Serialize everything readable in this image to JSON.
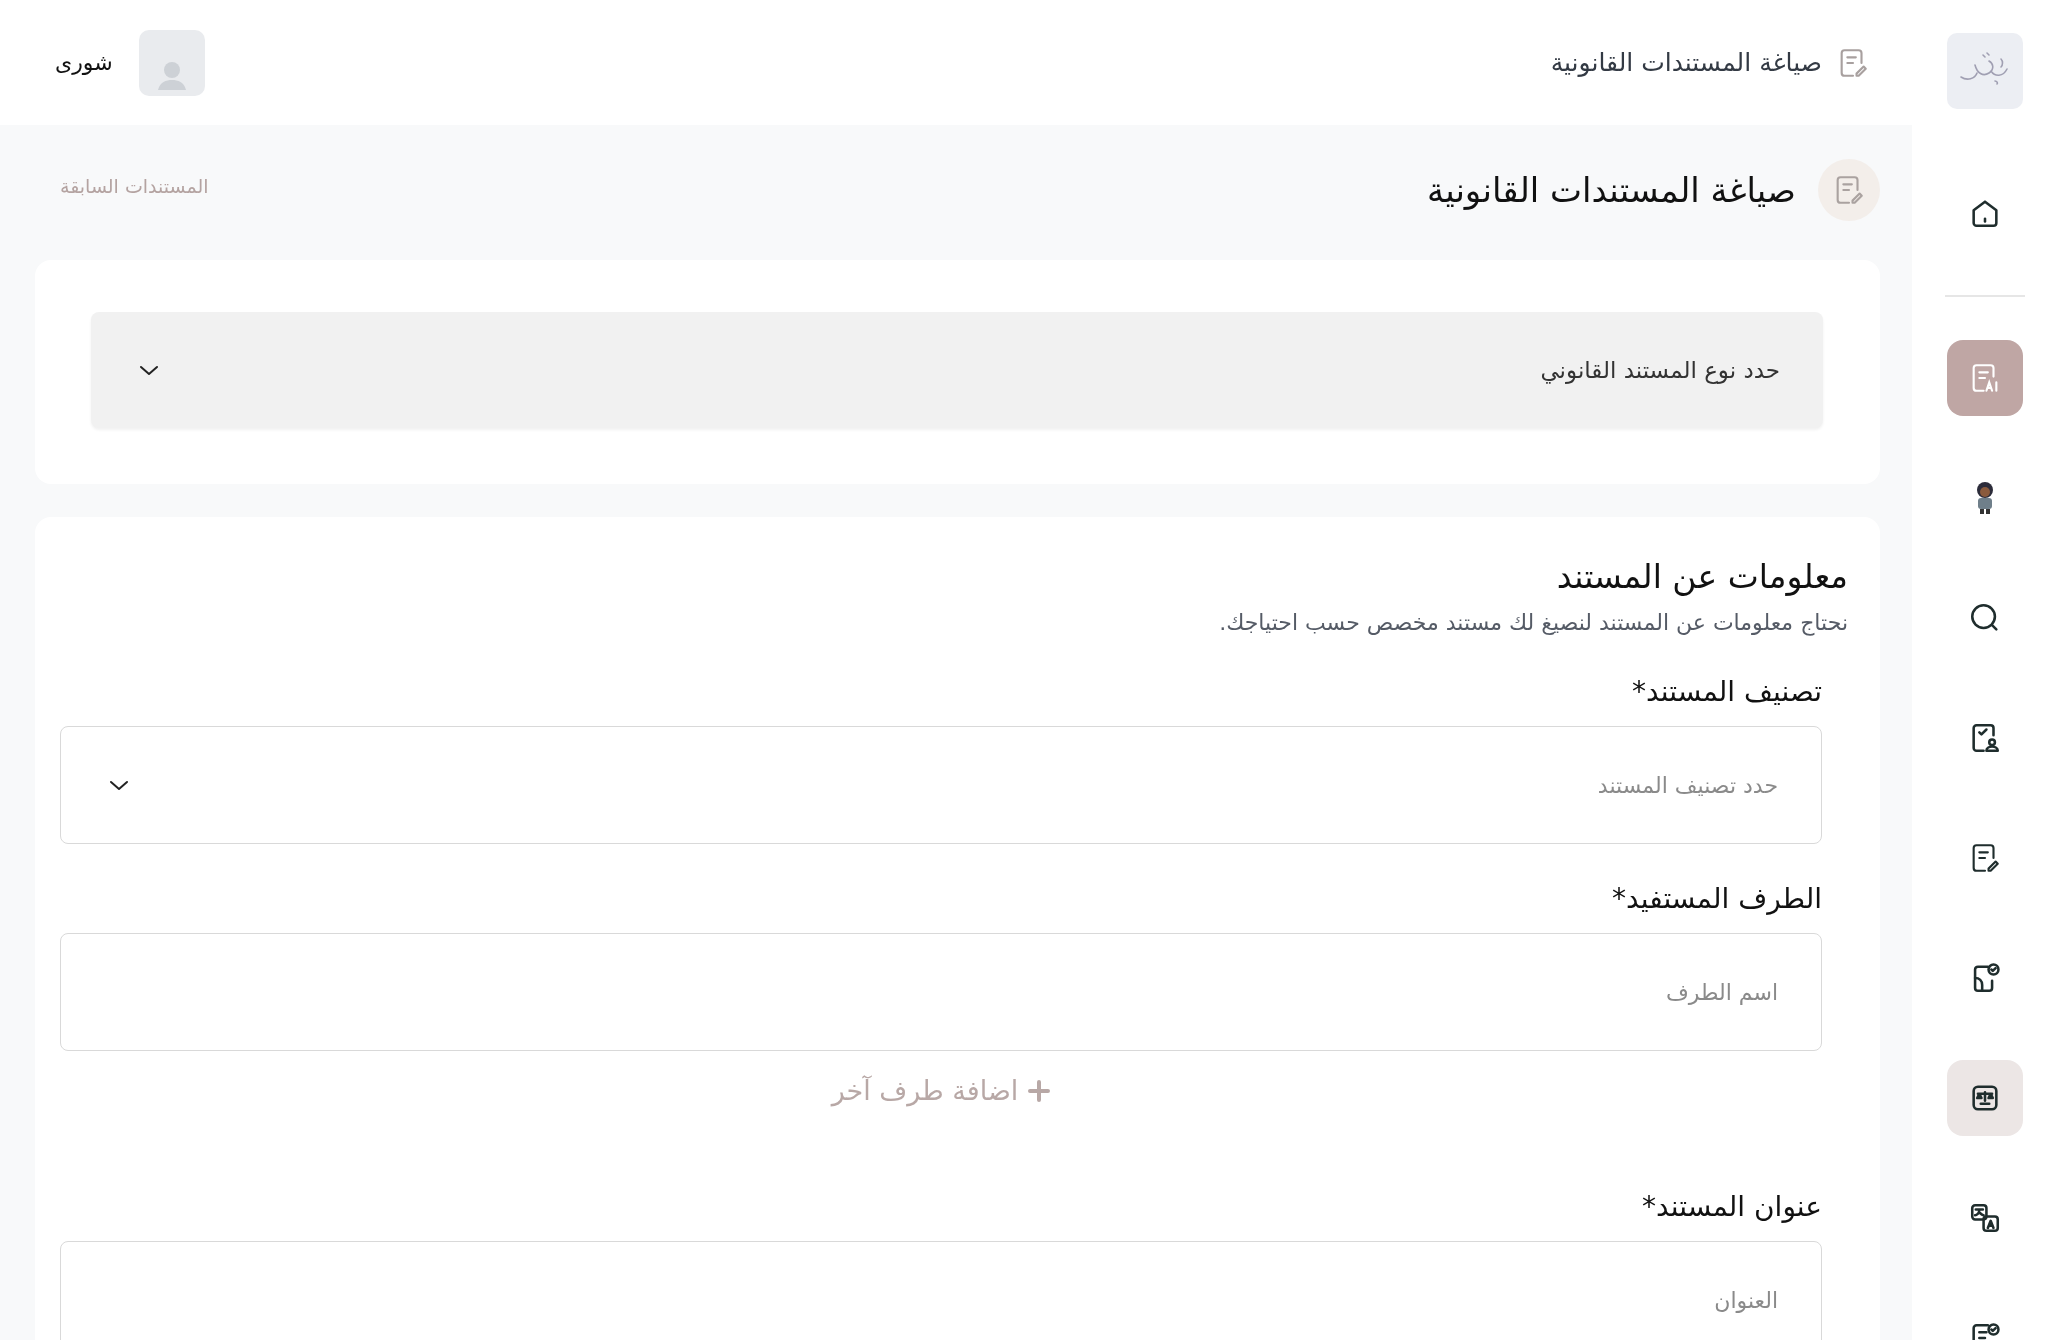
{
  "topbar": {
    "page_title": "صياغة المستندات القانونية",
    "user_name": "شورى"
  },
  "sidebar": {
    "items": [
      {
        "selected": false,
        "highlighted": false
      },
      {
        "selected": true,
        "highlighted": false
      },
      {
        "selected": false,
        "highlighted": false
      },
      {
        "selected": false,
        "highlighted": false
      },
      {
        "selected": false,
        "highlighted": false
      },
      {
        "selected": false,
        "highlighted": false
      },
      {
        "selected": false,
        "highlighted": false
      },
      {
        "selected": false,
        "highlighted": true
      },
      {
        "selected": false,
        "highlighted": false
      },
      {
        "selected": false,
        "highlighted": false
      }
    ]
  },
  "page": {
    "title": "صياغة المستندات القانونية",
    "previous_documents_link": "المستندات السابقة"
  },
  "document_type": {
    "placeholder": "حدد نوع المستند القانوني"
  },
  "info": {
    "heading": "معلومات عن المستند",
    "description": "نحتاج معلومات عن المستند لنصيغ لك مستند مخصص حسب احتياجك.",
    "fields": [
      {
        "kind": "select",
        "label": "تصنيف المستند*",
        "placeholder": "حدد تصنيف المستند"
      },
      {
        "kind": "text",
        "label": "الطرف المستفيد*",
        "placeholder": "اسم الطرف"
      },
      {
        "kind": "add",
        "label": "اضافة طرف آخر"
      },
      {
        "kind": "text",
        "label": "عنوان المستند*",
        "placeholder": "العنوان"
      }
    ]
  }
}
